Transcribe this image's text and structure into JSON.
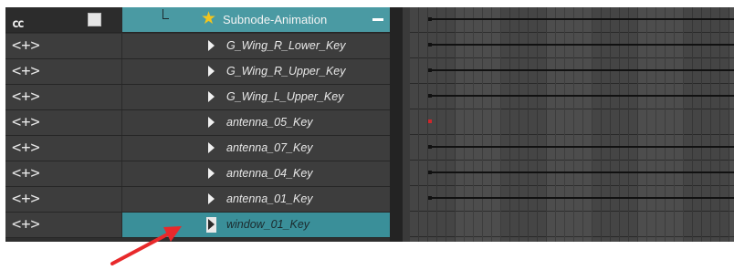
{
  "header": {
    "cc_glyph": "cc",
    "layer_name": "Subnode-Animation",
    "tree_glyph": "L"
  },
  "ctrl_label": "<+>",
  "layers": [
    {
      "label": "G_Wing_R_Lower_Key",
      "selected": false,
      "key_color": "#111111"
    },
    {
      "label": "G_Wing_R_Upper_Key",
      "selected": false,
      "key_color": "#111111"
    },
    {
      "label": "G_Wing_L_Upper_Key",
      "selected": false,
      "key_color": "#111111"
    },
    {
      "label": "antenna_05_Key",
      "selected": false,
      "key_color": "#d0262b"
    },
    {
      "label": "antenna_07_Key",
      "selected": false,
      "key_color": "#111111"
    },
    {
      "label": "antenna_04_Key",
      "selected": false,
      "key_color": "#111111"
    },
    {
      "label": "antenna_01_Key",
      "selected": false,
      "key_color": "#111111"
    },
    {
      "label": "window_01_Key",
      "selected": true,
      "key_color": null
    }
  ],
  "colors": {
    "selection": "#3a8f99",
    "pointer": "#e8292b"
  }
}
